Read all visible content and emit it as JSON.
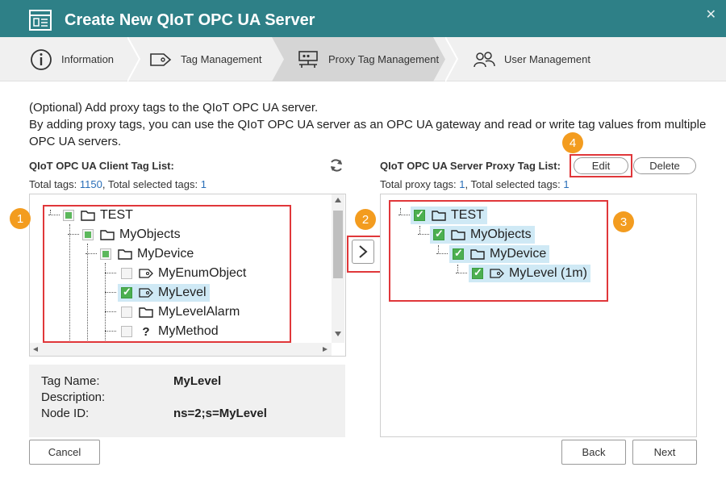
{
  "window": {
    "title": "Create New QIoT OPC UA Server",
    "close_glyph": "✕"
  },
  "steps": [
    {
      "label": "Information",
      "icon": "info-icon"
    },
    {
      "label": "Tag Management",
      "icon": "tag-icon"
    },
    {
      "label": "Proxy Tag Management",
      "icon": "network-icon",
      "active": true
    },
    {
      "label": "User Management",
      "icon": "users-icon"
    }
  ],
  "intro": {
    "line1": "(Optional) Add proxy tags to the QIoT OPC UA server.",
    "line2": "By adding proxy tags, you can use the QIoT OPC UA server as an OPC UA gateway and read or write tag values from multiple OPC UA servers."
  },
  "client": {
    "title": "QIoT OPC UA Client Tag List:",
    "total_label": "Total tags: ",
    "total": "1150",
    "selected_label": ", Total selected tags: ",
    "selected": "1",
    "tree": [
      {
        "label": "TEST",
        "type": "folder",
        "check": "partial"
      },
      {
        "label": "MyObjects",
        "type": "folder",
        "check": "partial"
      },
      {
        "label": "MyDevice",
        "type": "folder",
        "check": "partial"
      },
      {
        "label": "MyEnumObject",
        "type": "tag",
        "check": "none"
      },
      {
        "label": "MyLevel",
        "type": "tag",
        "check": "checked",
        "selected": true
      },
      {
        "label": "MyLevelAlarm",
        "type": "folder",
        "check": "none"
      },
      {
        "label": "MyMethod",
        "type": "method",
        "check": "none"
      }
    ]
  },
  "proxy": {
    "title": "QIoT OPC UA Server Proxy Tag List:",
    "total_label": "Total proxy tags: ",
    "total": "1",
    "selected_label": ", Total selected tags: ",
    "selected": "1",
    "edit_label": "Edit",
    "delete_label": "Delete",
    "tree": [
      {
        "label": "TEST",
        "type": "folder"
      },
      {
        "label": "MyObjects",
        "type": "folder"
      },
      {
        "label": "MyDevice",
        "type": "folder"
      },
      {
        "label": "MyLevel (1m)",
        "type": "tag"
      }
    ]
  },
  "details": {
    "tag_name_label": "Tag Name:",
    "tag_name": "MyLevel",
    "description_label": "Description:",
    "description": "",
    "node_id_label": "Node ID:",
    "node_id": "ns=2;s=MyLevel"
  },
  "add_arrow": "›",
  "badges": [
    "1",
    "2",
    "3",
    "4"
  ],
  "footer": {
    "cancel": "Cancel",
    "back": "Back",
    "next": "Next"
  },
  "colors": {
    "titlebar": "#2e8087",
    "accent_number": "#2a6fb8",
    "highlight_box": "#e0373a",
    "badge": "#f39c1f",
    "check_green": "#4caf50",
    "selection": "#cfe9f5"
  }
}
